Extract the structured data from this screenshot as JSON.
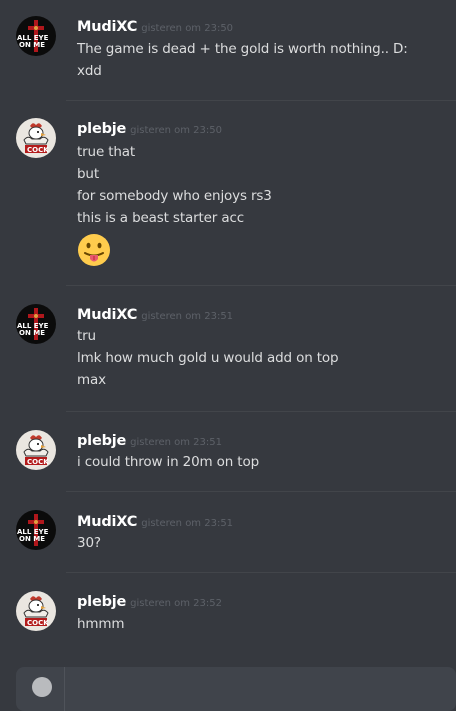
{
  "messages": [
    {
      "username": "MudiXC",
      "timestamp": "gisteren om 23:50",
      "lines": [
        "The game is dead + the gold is worth nothing.. D:",
        "xdd"
      ]
    },
    {
      "username": "plebje",
      "timestamp": "gisteren om 23:50",
      "lines": [
        "true that",
        "but",
        "for somebody who enjoys rs3",
        "this is a beast starter acc"
      ],
      "emoji": "stuck-out-tongue-emoji"
    },
    {
      "username": "MudiXC",
      "timestamp": "gisteren om 23:51",
      "lines": [
        "tru",
        "lmk how much gold u would add on top",
        "max"
      ]
    },
    {
      "username": "plebje",
      "timestamp": "gisteren om 23:51",
      "lines": [
        "i could throw in 20m on top"
      ]
    },
    {
      "username": "MudiXC",
      "timestamp": "gisteren om 23:51",
      "lines": [
        "30?"
      ]
    },
    {
      "username": "plebje",
      "timestamp": "gisteren om 23:52",
      "lines": [
        "hmmm"
      ]
    }
  ],
  "avatars": {
    "mudixc": {
      "icon": "all-eyes-on-me-cross-avatar",
      "text_top": "ALL EYE",
      "text_bottom": "ON ME",
      "accent": "#b0171c"
    },
    "plebje": {
      "icon": "muscle-rooster-avatar",
      "text": "COCK",
      "accent": "#c0392b"
    }
  },
  "colors": {
    "background": "#36393f",
    "username": "#ffffff",
    "text": "#dcddde",
    "timestamp": "#72767d",
    "divider": "#42454a",
    "composer": "#40444b"
  },
  "composer": {
    "attach_icon": "plus-circle-icon"
  }
}
